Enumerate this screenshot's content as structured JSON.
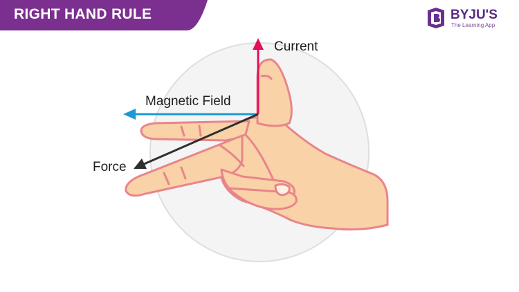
{
  "title": "RIGHT HAND RULE",
  "brand": {
    "name": "BYJU'S",
    "tagline": "The Learning App"
  },
  "labels": {
    "current": "Current",
    "magnetic_field": "Magnetic Field",
    "force": "Force"
  },
  "colors": {
    "banner": "#7b2f8e",
    "brand": "#5a2a82",
    "current_arrow": "#e2105c",
    "field_arrow": "#1b9ad6",
    "force_arrow": "#2f2f2f",
    "skin": "#f9d2a8",
    "skin_outline": "#e8858a"
  }
}
